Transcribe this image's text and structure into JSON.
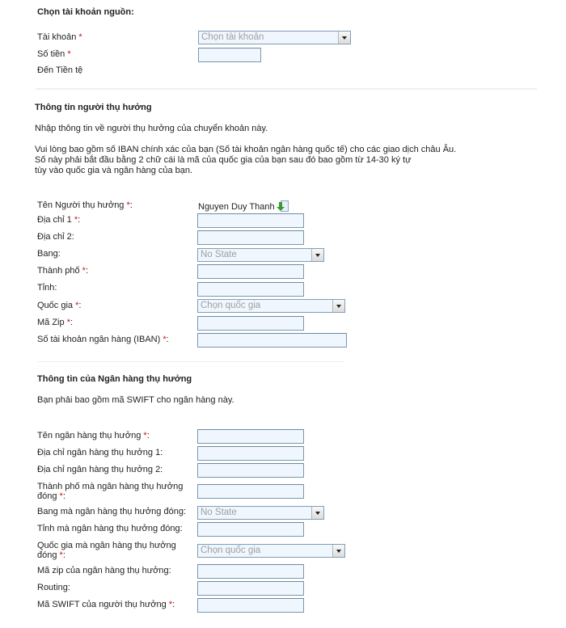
{
  "source_account": {
    "heading": "Chọn tài khoản nguồn:",
    "account_label": "Tài khoản",
    "account_placeholder": "Chọn tài khoản",
    "amount_label": "Số tiền",
    "amount_value": "",
    "to_currency_label": "Đến Tiền tệ",
    "required_mark": "*"
  },
  "beneficiary": {
    "heading": "Thông tin người thụ hưởng",
    "intro": "Nhập thông tin về người thụ hưởng của chuyển khoản này.",
    "iban_note_lines": [
      "Vui lòng bao gồm số IBAN chính xác của bạn (Số tài khoản ngân hàng quốc tế) cho các giao dịch châu Âu.",
      "Số này phải bắt đầu bằng 2 chữ cái là mã của quốc gia của bạn sau đó bao gồm từ 14-30 ký tự",
      "tùy vào quốc gia và ngân hàng của bạn."
    ],
    "name_label": "Tên Người thụ hưởng",
    "name_value": "Nguyen Duy Thanh",
    "name_icon": "import-contact-icon",
    "address1_label": "Địa chỉ 1",
    "address2_label": "Địa chỉ 2:",
    "state_label": "Bang:",
    "state_value": "No State",
    "city_label": "Thành phố",
    "province_label": "Tỉnh:",
    "country_label": "Quốc gia",
    "country_placeholder": "Chọn quốc gia",
    "zip_label": "Mã Zip",
    "iban_label": "Số tài khoản ngân hàng (IBAN)",
    "required_suffix": ":"
  },
  "bank": {
    "heading": "Thông tin của Ngân hàng thụ hưởng",
    "intro": "Bạn phải bao gồm mã SWIFT cho ngân hàng này.",
    "bank_name_label": "Tên ngân hàng thụ hưởng",
    "bank_address1_label": "Địa chỉ ngân hàng thụ hưởng 1:",
    "bank_address2_label": "Địa chỉ ngân hàng thụ hưởng 2:",
    "bank_city_label_line1": "Thành phố mà ngân hàng thụ hưởng",
    "bank_city_label_line2": "đóng",
    "bank_state_label": "Bang mà ngân hàng thụ hưởng đóng:",
    "bank_state_value": "No State",
    "bank_province_label": "Tỉnh mà ngân hàng thụ hưởng đóng:",
    "bank_country_label_line1": "Quốc gia mà ngân hàng thụ hưởng",
    "bank_country_label_line2": "đóng",
    "bank_country_placeholder": "Chọn quốc gia",
    "bank_zip_label": "Mã zip của ngân hàng thụ hưởng:",
    "routing_label": "Routing:",
    "swift_label": "Mã SWIFT của người thụ hưởng"
  },
  "colors": {
    "required": "#cc1111",
    "input_bg": "#eff6fd",
    "input_border": "#7b97ad",
    "separator": "#efefef"
  }
}
